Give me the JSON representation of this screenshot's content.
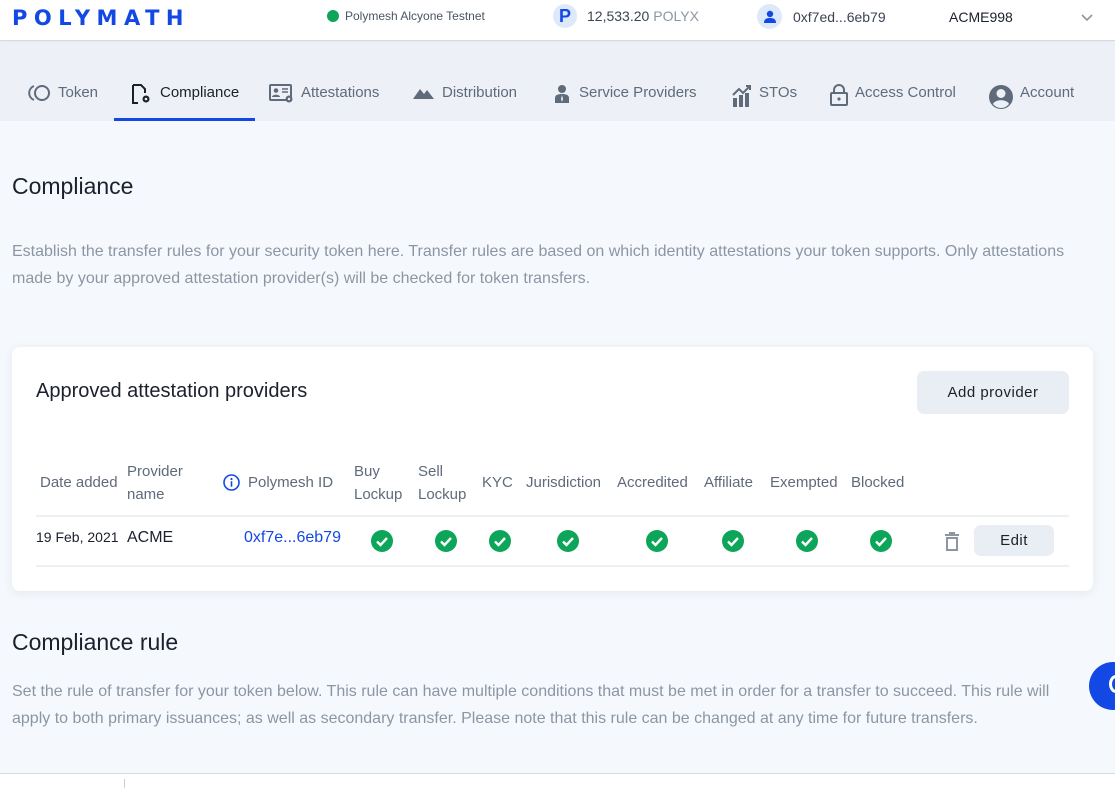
{
  "header": {
    "logo": "POLYMATH",
    "network": "Polymesh Alcyone Testnet",
    "network_status_color": "#0ca559",
    "balance_value": "12,533.20",
    "balance_unit": "POLYX",
    "account_address": "0xf7ed...6eb79",
    "selected_token": "ACME998"
  },
  "tabs": [
    {
      "label": "Token",
      "icon": "token-icon",
      "active": false
    },
    {
      "label": "Compliance",
      "icon": "compliance-icon",
      "active": true
    },
    {
      "label": "Attestations",
      "icon": "attestations-icon",
      "active": false
    },
    {
      "label": "Distribution",
      "icon": "distribution-icon",
      "active": false
    },
    {
      "label": "Service Providers",
      "icon": "service-providers-icon",
      "active": false
    },
    {
      "label": "STOs",
      "icon": "stos-icon",
      "active": false
    },
    {
      "label": "Access Control",
      "icon": "lock-icon",
      "active": false
    },
    {
      "label": "Account",
      "icon": "account-icon",
      "active": false
    }
  ],
  "page": {
    "title": "Compliance",
    "description": "Establish the transfer rules for your security token here. Transfer rules are based on which identity attestations your token supports. Only attestations made by your approved attestation provider(s) will be checked for token transfers."
  },
  "providers_card": {
    "title": "Approved attestation providers",
    "add_button": "Add provider",
    "columns": {
      "date_added": "Date added",
      "provider_name_1": "Provider",
      "provider_name_2": "name",
      "polymesh_id": "Polymesh ID",
      "buy_lockup_1": "Buy",
      "buy_lockup_2": "Lockup",
      "sell_lockup_1": "Sell",
      "sell_lockup_2": "Lockup",
      "kyc": "KYC",
      "jurisdiction": "Jurisdiction",
      "accredited": "Accredited",
      "affiliate": "Affiliate",
      "exempted": "Exempted",
      "blocked": "Blocked"
    },
    "rows": [
      {
        "date_added": "19 Feb, 2021",
        "provider_name": "ACME",
        "polymesh_id": "0xf7e...6eb79",
        "buy_lockup": true,
        "sell_lockup": true,
        "kyc": true,
        "jurisdiction": true,
        "accredited": true,
        "affiliate": true,
        "exempted": true,
        "blocked": true,
        "edit_label": "Edit"
      }
    ]
  },
  "rule_section": {
    "title": "Compliance rule",
    "description": "Set the rule of transfer for your token below. This rule can have multiple conditions that must be met in order for a transfer to succeed. This rule will apply to both primary issuances; as well as secondary transfer. Please note that this rule can be changed at any time for future transfers."
  },
  "colors": {
    "brand": "#1348e4",
    "check": "#0ca559",
    "link": "#1348e4"
  }
}
